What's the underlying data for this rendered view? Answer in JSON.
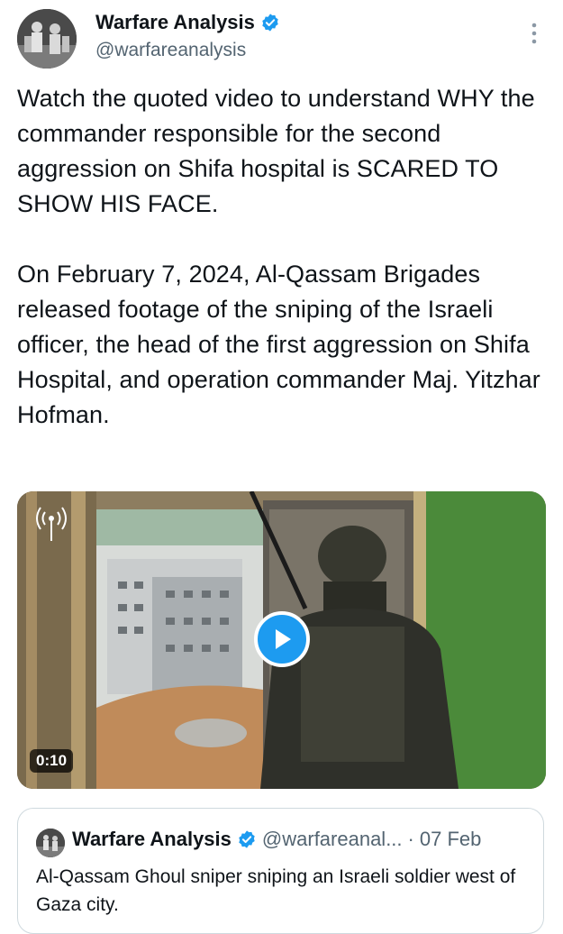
{
  "author": {
    "name": "Warfare Analysis",
    "handle": "@warfareanalysis",
    "verified": true
  },
  "tweet": {
    "text": "Watch the quoted video to understand WHY the commander responsible for the second aggression on Shifa hospital is SCARED TO SHOW HIS FACE.\n\nOn February 7, 2024, Al-Qassam Brigades released footage of the sniping of the Israeli officer, the head of the first aggression on Shifa Hospital, and operation commander Maj. Yitzhar Hofman."
  },
  "media": {
    "type": "video",
    "duration": "0:10",
    "icons": [
      "play-icon",
      "radio-broadcast-icon"
    ]
  },
  "quoted_tweet": {
    "name": "Warfare Analysis",
    "handle": "@warfareanal...",
    "separator": "·",
    "date": "07 Feb",
    "text": "Al-Qassam Ghoul sniper sniping an Israeli soldier west of Gaza city."
  },
  "colors": {
    "accent": "#1d9bf0",
    "secondary_text": "#536471",
    "border": "#cfd9de"
  }
}
